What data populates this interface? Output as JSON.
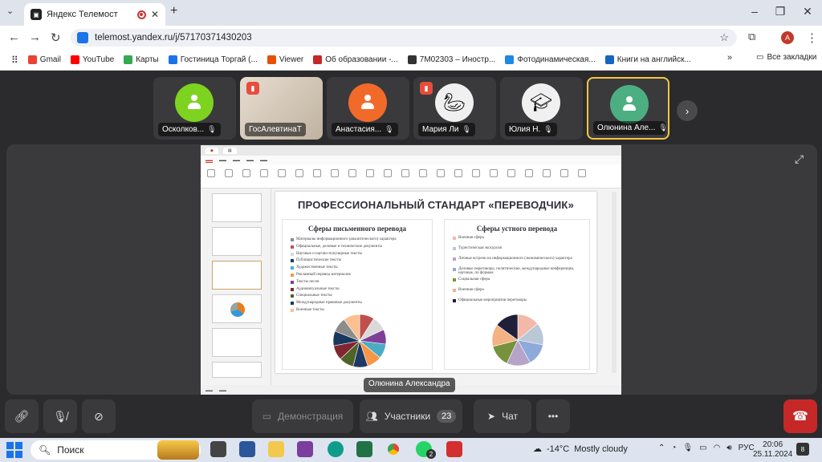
{
  "browser": {
    "tab_title": "Яндекс Телемост",
    "tab_icon": "telemost-icon",
    "new_tab": "+",
    "url": "telemost.yandex.ru/j/57170371430203",
    "profile_letter": "А",
    "bookmarks": [
      {
        "label": "Gmail",
        "color": "#ea4335"
      },
      {
        "label": "YouTube",
        "color": "#ff0000"
      },
      {
        "label": "Карты",
        "color": "#34a853"
      },
      {
        "label": "Гостиница Торгай (...",
        "color": "#1a73e8"
      },
      {
        "label": "Viewer",
        "color": "#e65100"
      },
      {
        "label": "Об образовании -...",
        "color": "#c62828"
      },
      {
        "label": "7М02303 – Иностр...",
        "color": "#333333"
      },
      {
        "label": "Фотодинамическая...",
        "color": "#1e88e5"
      },
      {
        "label": "Книги на английск...",
        "color": "#1565c0"
      }
    ],
    "all_bookmarks": "Все закладки"
  },
  "participants": [
    {
      "name": "Осколков...",
      "avatar_color": "#7ed321",
      "kind": "person"
    },
    {
      "name": "ГосАлевтинаТ",
      "avatar_color": "#d8cbb8",
      "kind": "photo"
    },
    {
      "name": "Анастасия...",
      "avatar_color": "#f26a2a",
      "kind": "person"
    },
    {
      "name": "Мария Ли",
      "avatar_color": "#f0f0f0",
      "kind": "goose"
    },
    {
      "name": "Юлия Н.",
      "avatar_color": "#f0f0f0",
      "kind": "cap"
    },
    {
      "name": "Олюнина Але...",
      "avatar_color": "#4caf82",
      "kind": "person",
      "active": true
    }
  ],
  "presentation": {
    "speaker_label": "Олюнина Александра",
    "slide_title": "ПРОФЕССИОНАЛЬНЫЙ СТАНДАРТ «ПЕРЕВОДЧИК»",
    "left_panel_title": "Сферы письменного перевода",
    "left_items": [
      {
        "text": "Материалы информационного (аналитического) характера",
        "color": "#8c8c8c"
      },
      {
        "text": "Официальные, деловые и технические документы",
        "color": "#c0504d"
      },
      {
        "text": "Научные и научно-популярные тексты",
        "color": "#d9d9d9"
      },
      {
        "text": "Публицистические тексты",
        "color": "#1f3864"
      },
      {
        "text": "Художественные тексты",
        "color": "#4bacc6"
      },
      {
        "text": "Рекламный перевод материалов",
        "color": "#f79646"
      },
      {
        "text": "Тексты песен",
        "color": "#7f3f98"
      },
      {
        "text": "Аудиовизуальные тексты",
        "color": "#7f2630"
      },
      {
        "text": "Специальные тексты",
        "color": "#4f6228"
      },
      {
        "text": "Международные правовые документы",
        "color": "#17375e"
      },
      {
        "text": "Военные тексты",
        "color": "#fac090"
      }
    ],
    "right_panel_title": "Сферы устного перевода",
    "right_items": [
      {
        "text": "Военная сфера",
        "color": "#f2b8a8"
      },
      {
        "text": "Туристическая экскурсия",
        "color": "#b9c7d6"
      },
      {
        "text": "Личные встречи на информационного (экономического) характера",
        "color": "#b6a3c8"
      },
      {
        "text": "Деловые переговоры, политические, международные конференции, научные, по формам",
        "color": "#8eaadb"
      },
      {
        "text": "Социальная сфера",
        "color": "#76923c"
      },
      {
        "text": "Военная сфера",
        "color": "#f4b183"
      },
      {
        "text": "Официальные мероприятия переговоры",
        "color": "#1f1f3a"
      }
    ],
    "left_pie": [
      {
        "value": 9,
        "color": "#c0504d"
      },
      {
        "value": 9,
        "color": "#d9d9d9"
      },
      {
        "value": 9,
        "color": "#7f3f98"
      },
      {
        "value": 9,
        "color": "#4bacc6"
      },
      {
        "value": 9,
        "color": "#f79646"
      },
      {
        "value": 9,
        "color": "#1f3864"
      },
      {
        "value": 9,
        "color": "#4f6228"
      },
      {
        "value": 9,
        "color": "#7f2630"
      },
      {
        "value": 9,
        "color": "#17375e"
      },
      {
        "value": 9,
        "color": "#8c8c8c"
      },
      {
        "value": 10,
        "color": "#fac090"
      }
    ],
    "right_pie": [
      {
        "value": 14,
        "color": "#f2b8a8"
      },
      {
        "value": 14,
        "color": "#b9c7d6"
      },
      {
        "value": 14,
        "color": "#8eaadb"
      },
      {
        "value": 15,
        "color": "#b6a3c8"
      },
      {
        "value": 14,
        "color": "#76923c"
      },
      {
        "value": 14,
        "color": "#f4b183"
      },
      {
        "value": 15,
        "color": "#1f1f3a"
      }
    ]
  },
  "toolbar": {
    "demo_label": "Демонстрация",
    "participants_label": "Участники",
    "participants_count": "23",
    "chat_label": "Чат",
    "more_label": "•••"
  },
  "taskbar": {
    "search_placeholder": "Поиск",
    "chrome_badge": "2",
    "weather_temp": "-14°C",
    "weather_text": "Mostly cloudy",
    "lang": "РУС",
    "time": "20:06",
    "date": "25.11.2024"
  }
}
